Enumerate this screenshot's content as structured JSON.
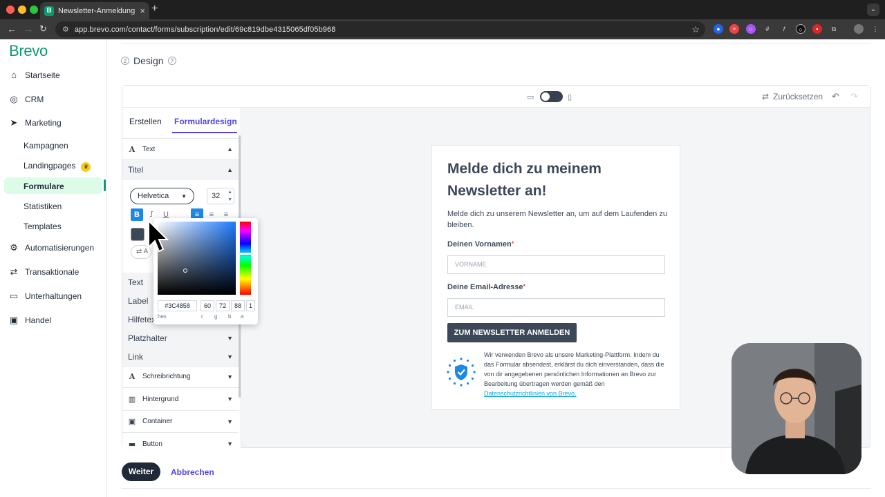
{
  "browser": {
    "tab_title": "Newsletter-Anmeldung - Brevo",
    "tab_favicon": "B",
    "url": "app.brevo.com/contact/forms/subscription/edit/69c819dbe4315065df05b968"
  },
  "sidebar": {
    "logo": "Brevo",
    "items": [
      {
        "label": "Startseite",
        "icon": "home-icon"
      },
      {
        "label": "CRM",
        "icon": "crm-icon"
      },
      {
        "label": "Marketing",
        "icon": "send-icon"
      }
    ],
    "marketing_sub": [
      {
        "label": "Kampagnen"
      },
      {
        "label": "Landingpages"
      },
      {
        "label": "Formulare"
      },
      {
        "label": "Statistiken"
      },
      {
        "label": "Templates"
      }
    ],
    "items2": [
      {
        "label": "Automatisierungen",
        "icon": "automation-icon"
      },
      {
        "label": "Transaktionale",
        "icon": "transfer-icon"
      },
      {
        "label": "Unterhaltungen",
        "icon": "chat-icon"
      },
      {
        "label": "Handel",
        "icon": "shop-icon"
      }
    ]
  },
  "main": {
    "step_number": "2",
    "section_title": "Design"
  },
  "editor": {
    "reset_label": "Zurücksetzen",
    "tabs": [
      "Erstellen",
      "Formulardesign"
    ],
    "rows": {
      "text_header": "Text",
      "titel": "Titel",
      "text": "Text",
      "label": "Label",
      "hilfetext": "Hilfetext",
      "platzhalter": "Platzhalter",
      "link": "Link",
      "schreibrichtung": "Schreibrichtung",
      "hintergrund": "Hintergrund",
      "container": "Container",
      "button": "Button"
    },
    "font": "Helvetica",
    "font_size": "32",
    "format_bold": "B",
    "format_italic": "I",
    "format_underline": "U",
    "reset_small_label": "A"
  },
  "color_picker": {
    "hex": "#3C4858",
    "r": "60",
    "g": "72",
    "b": "88",
    "a": "1",
    "labels": {
      "hex": "hex",
      "r": "r",
      "g": "g",
      "b": "b",
      "a": "a"
    }
  },
  "form_preview": {
    "title": "Melde dich zu meinem Newsletter an!",
    "description": "Melde dich zu unserem Newsletter an, um auf dem Laufenden zu bleiben.",
    "field1_label": "Deinen Vornamen",
    "field1_placeholder": "VORNAME",
    "field2_label": "Deine Email-Adresse",
    "field2_placeholder": "EMAIL",
    "required_mark": "*",
    "submit": "ZUM NEWSLETTER ANMELDEN",
    "gdpr_text": "Wir verwenden Brevo als unsere Marketing-Plattform. Indem du das Formular absendest, erklärst du dich einverstanden, dass die von dir angegebenen persönlichen Informationen an Brevo zur Bearbeitung übertragen werden gemäß den",
    "gdpr_link": "Datenschutzrichtlinien von Brevo."
  },
  "footer": {
    "next": "Weiter",
    "cancel": "Abbrechen"
  },
  "colors": {
    "brand": "#0b996e",
    "accent": "#4f46e5",
    "text_color": "#3c4858"
  }
}
